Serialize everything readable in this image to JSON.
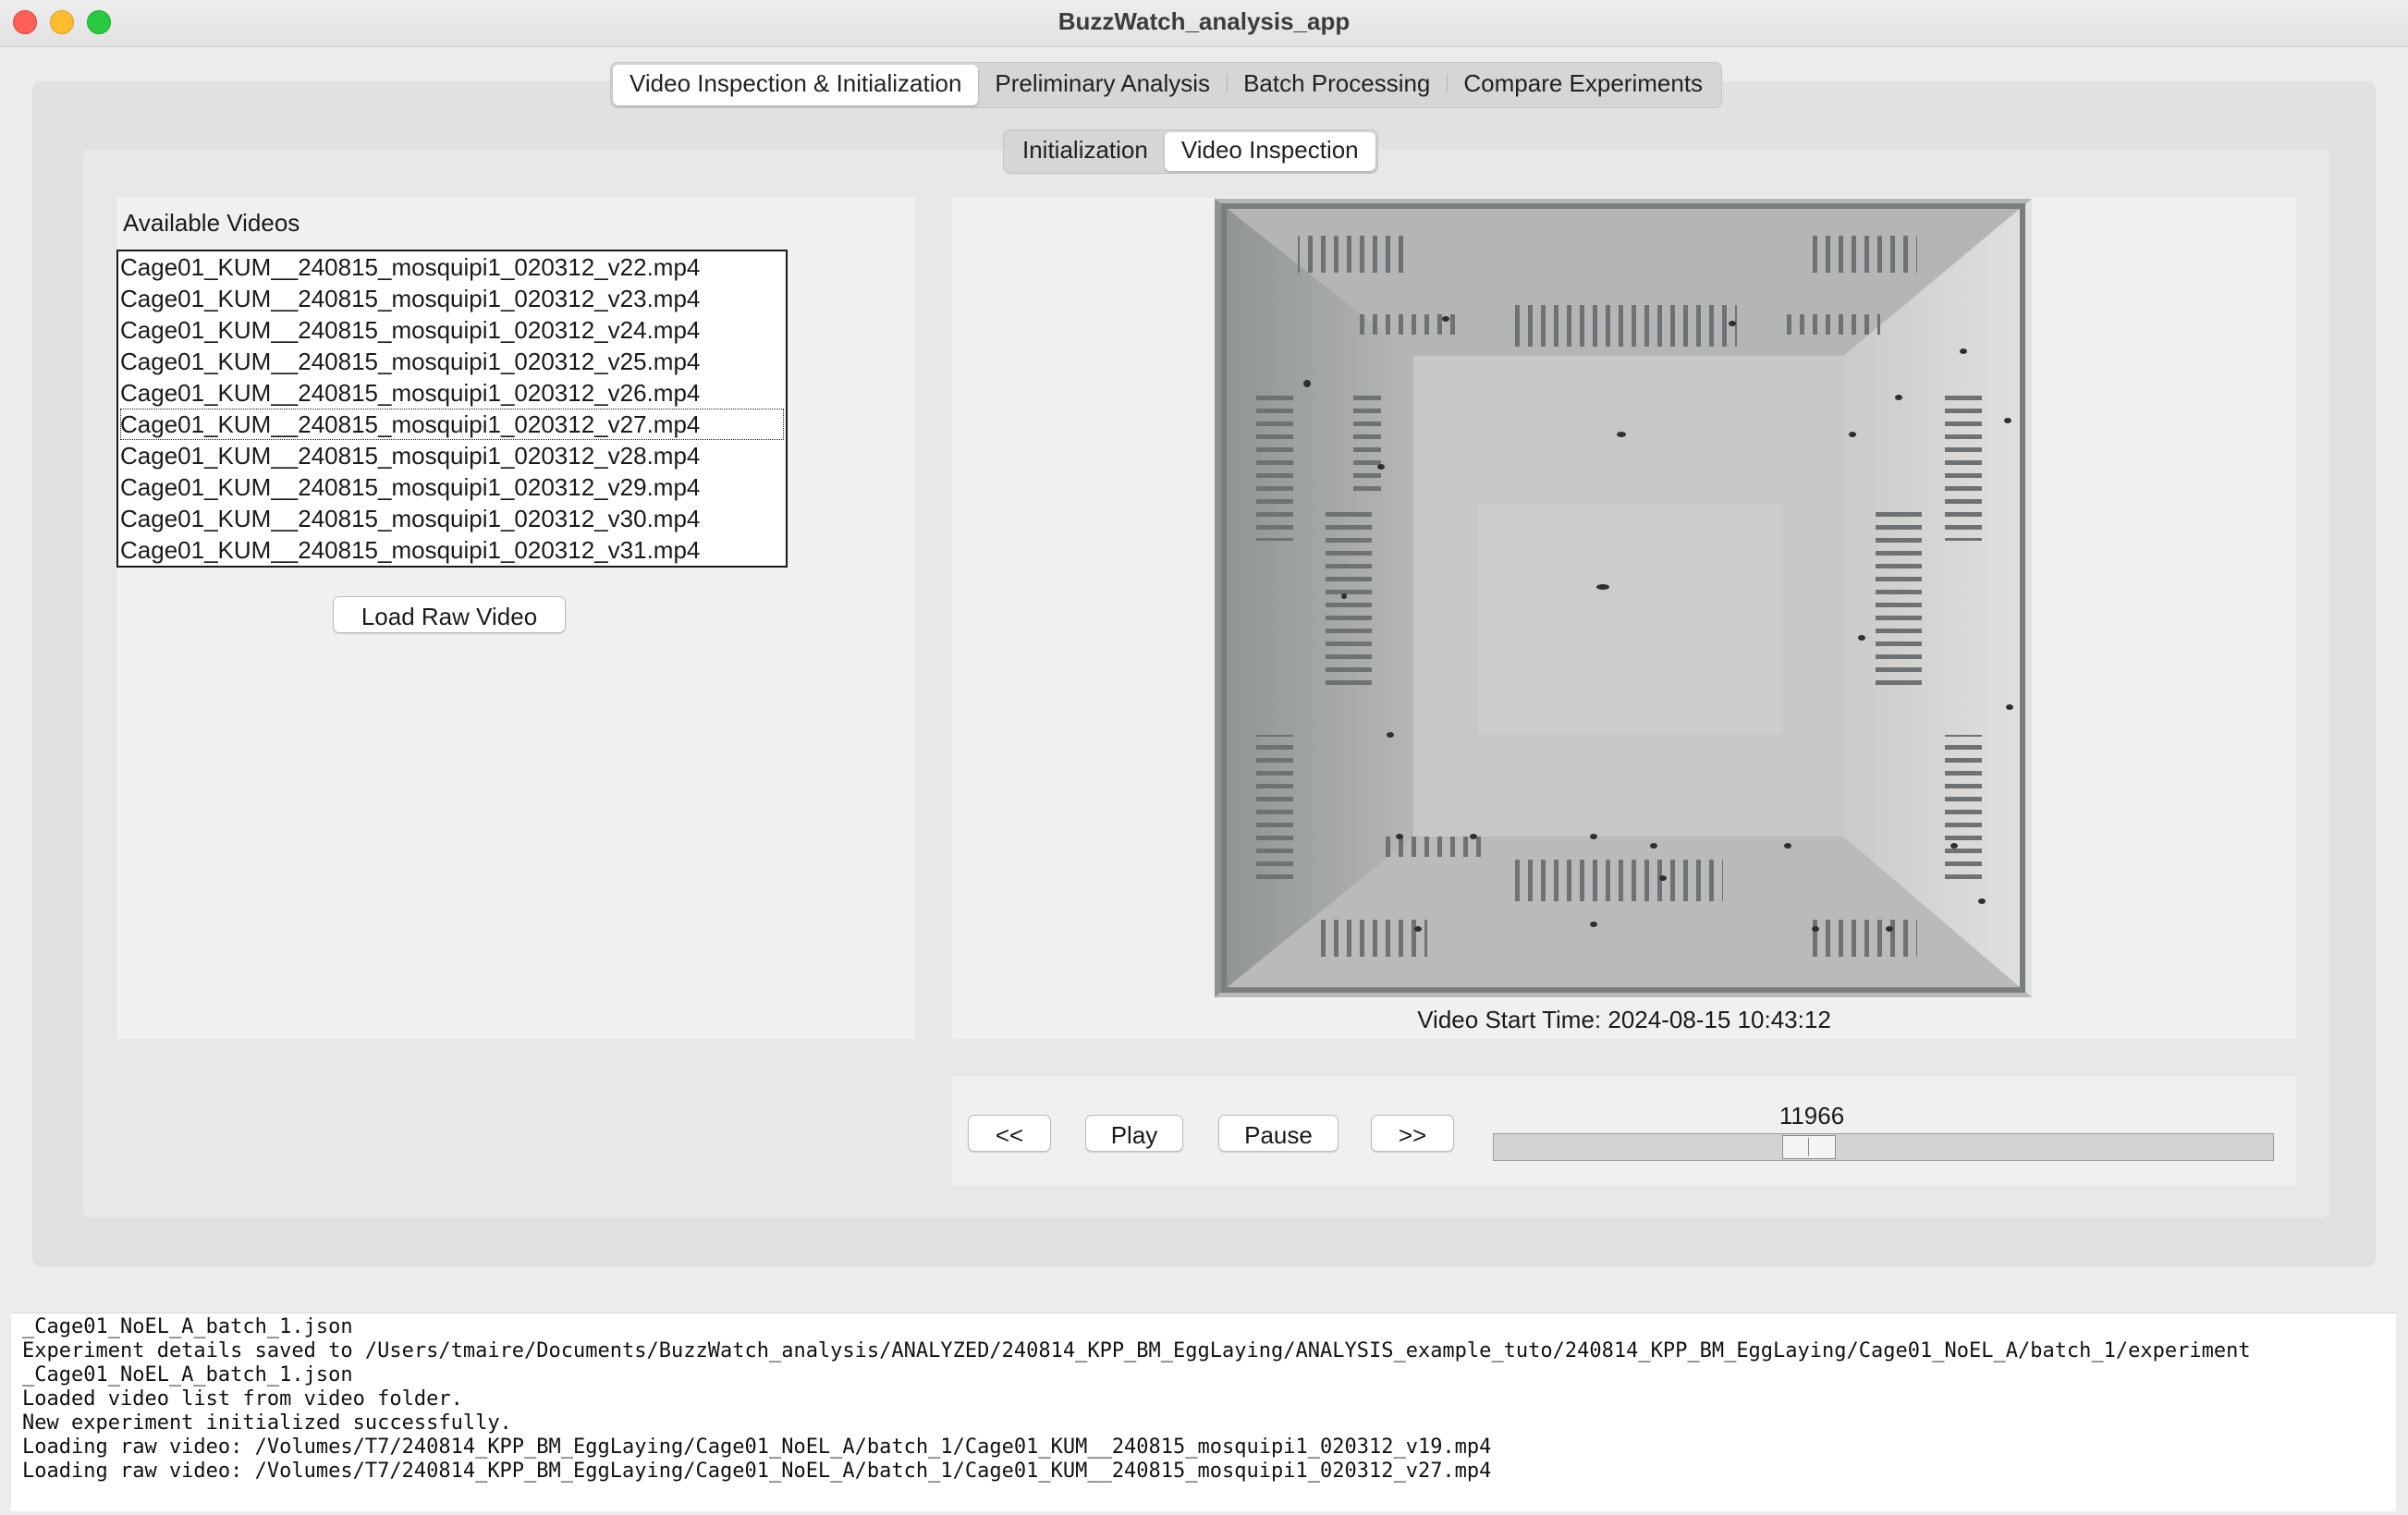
{
  "window": {
    "title": "BuzzWatch_analysis_app"
  },
  "main_tabs": [
    {
      "label": "Video Inspection & Initialization",
      "active": true
    },
    {
      "label": "Preliminary Analysis",
      "active": false
    },
    {
      "label": "Batch Processing",
      "active": false
    },
    {
      "label": "Compare Experiments",
      "active": false
    }
  ],
  "sub_tabs": [
    {
      "label": "Initialization",
      "active": false
    },
    {
      "label": "Video Inspection",
      "active": true
    }
  ],
  "videos": {
    "label": "Available Videos",
    "items": [
      "Cage01_KUM__240815_mosquipi1_020312_v22.mp4",
      "Cage01_KUM__240815_mosquipi1_020312_v23.mp4",
      "Cage01_KUM__240815_mosquipi1_020312_v24.mp4",
      "Cage01_KUM__240815_mosquipi1_020312_v25.mp4",
      "Cage01_KUM__240815_mosquipi1_020312_v26.mp4",
      "Cage01_KUM__240815_mosquipi1_020312_v27.mp4",
      "Cage01_KUM__240815_mosquipi1_020312_v28.mp4",
      "Cage01_KUM__240815_mosquipi1_020312_v29.mp4",
      "Cage01_KUM__240815_mosquipi1_020312_v30.mp4",
      "Cage01_KUM__240815_mosquipi1_020312_v31.mp4"
    ],
    "focused_item": "Cage01_KUM__240815_mosquipi1_020312_v27.mp4",
    "load_button": "Load Raw Video"
  },
  "player": {
    "start_time": "Video Start Time: 2024-08-15 10:43:12",
    "rewind_label": "<<",
    "play_label": "Play",
    "pause_label": "Pause",
    "forward_label": ">>",
    "frame_number": "11966",
    "slider_position_fraction": 0.39
  },
  "console": {
    "lines": [
      "_Cage01_NoEL_A_batch_1.json",
      "Experiment details saved to /Users/tmaire/Documents/BuzzWatch_analysis/ANALYZED/240814_KPP_BM_EggLaying/ANALYSIS_example_tuto/240814_KPP_BM_EggLaying/Cage01_NoEL_A/batch_1/experiment",
      "_Cage01_NoEL_A_batch_1.json",
      "Loaded video list from video folder.",
      "New experiment initialized successfully.",
      "Loading raw video: /Volumes/T7/240814_KPP_BM_EggLaying/Cage01_NoEL_A/batch_1/Cage01_KUM__240815_mosquipi1_020312_v19.mp4",
      "Loading raw video: /Volumes/T7/240814_KPP_BM_EggLaying/Cage01_NoEL_A/batch_1/Cage01_KUM__240815_mosquipi1_020312_v27.mp4"
    ]
  }
}
